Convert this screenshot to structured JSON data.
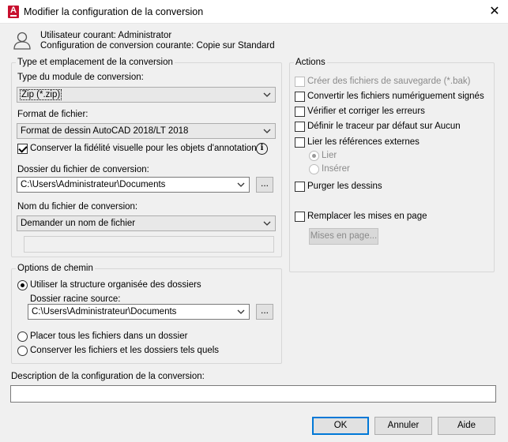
{
  "window": {
    "title": "Modifier la configuration de la conversion",
    "app_icon_letter": "A"
  },
  "header": {
    "user_line": "Utilisateur courant: Administrator",
    "config_line": "Configuration de conversion courante: Copie  sur Standard"
  },
  "type_group": {
    "legend": "Type et emplacement de la conversion",
    "module_label": "Type du module de conversion:",
    "module_value": "Zip (*.zip)",
    "format_label": "Format de fichier:",
    "format_value": "Format de dessin AutoCAD 2018/LT 2018",
    "fidelity_label": "Conserver la fidélité visuelle pour les objets d'annotation",
    "fidelity_checked": true,
    "folder_label": "Dossier du fichier de conversion:",
    "folder_value": "C:\\Users\\Administrateur\\Documents",
    "folder_browse": "...",
    "name_label": "Nom du fichier de conversion:",
    "name_value": "Demander un nom de fichier",
    "name_input": ""
  },
  "path_group": {
    "legend": "Options de chemin",
    "opt_structure": "Utiliser la structure organisée des dossiers",
    "source_label": "Dossier racine source:",
    "source_value": "C:\\Users\\Administrateur\\Documents",
    "source_browse": "...",
    "opt_single": "Placer tous les fichiers dans un dossier",
    "opt_keep": "Conserver les fichiers et les dossiers tels quels",
    "selected": "structure"
  },
  "actions_group": {
    "legend": "Actions",
    "backup": "Créer des fichiers de sauvegarde (*.bak)",
    "convert_signed": "Convertir les fichiers numériguement signés",
    "audit": "Vérifier et corriger les erreurs",
    "plotter": "Définir le traceur par défaut sur Aucun",
    "bind_xrefs": "Lier les références externes",
    "bind": "Lier",
    "insert": "Insérer",
    "purge": "Purger les dessins",
    "replace_layouts": "Remplacer les mises en page",
    "layouts_button": "Mises en page..."
  },
  "description": {
    "label": "Description de la configuration de la conversion:",
    "value": ""
  },
  "buttons": {
    "ok": "OK",
    "cancel": "Annuler",
    "help": "Aide"
  }
}
